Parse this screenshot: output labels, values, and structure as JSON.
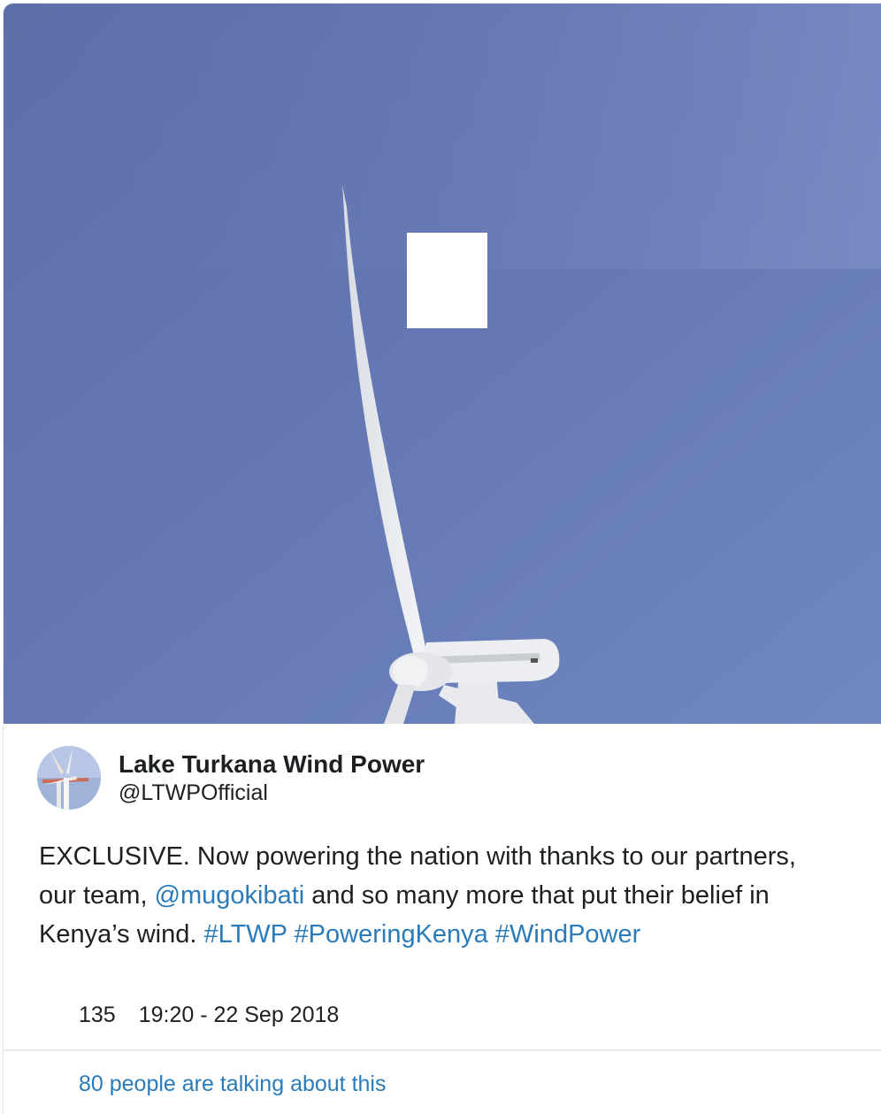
{
  "tweet": {
    "display_name": "Lake Turkana Wind Power",
    "handle": "@LTWPOfficial",
    "text_parts": {
      "p1": "EXCLUSIVE. Now powering the nation with thanks to our partners, our team, ",
      "mention": "@mugokibati",
      "p2": " and so many more that put their belief in Kenya’s wind. ",
      "hashtag1": "#LTWP",
      "sep1": " ",
      "hashtag2": "#PoweringKenya",
      "sep2": " ",
      "hashtag3": "#WindPower"
    },
    "like_count": "135",
    "timestamp": "19:20 - 22 Sep 2018",
    "talking_about": "80 people are talking about this"
  },
  "colors": {
    "sky": "#6a80b8",
    "link": "#2b7bb9",
    "text": "#1c2022"
  },
  "icons": {
    "like": "heart-icon"
  }
}
